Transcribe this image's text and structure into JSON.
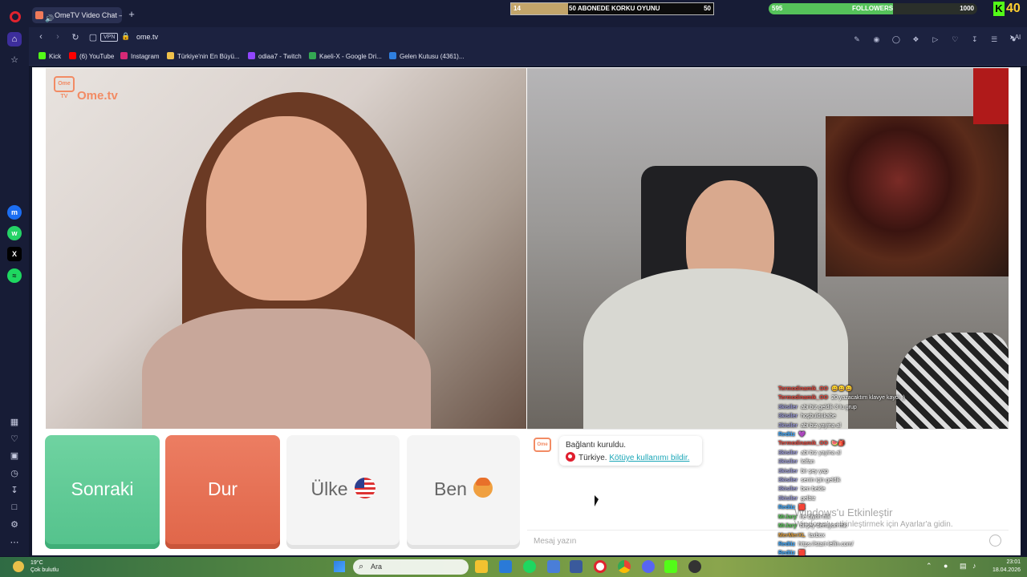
{
  "browser": {
    "tab_title": "OmeTV Video Chat —",
    "url": "ome.tv",
    "vpn_label": "VPN",
    "ai_label": "AI"
  },
  "stream_overlay": {
    "goal": {
      "current": "14",
      "title": "50 ABONEDE KORKU OYUNU",
      "target": "50",
      "progress": 0.28
    },
    "followers": {
      "current": "595",
      "label": "FOLLOWERS",
      "target": "1000",
      "progress": 0.595
    },
    "kick_count": "40"
  },
  "bookmarks": [
    {
      "label": "Kick",
      "color": "#53fc18"
    },
    {
      "label": "(6) YouTube",
      "color": "#ff0000"
    },
    {
      "label": "Instagram",
      "color": "#d62976"
    },
    {
      "label": "Türkiye'nin En Büyü...",
      "color": "#f0c14b"
    },
    {
      "label": "odiaa7 - Twitch",
      "color": "#9146ff"
    },
    {
      "label": "Kaeli-X - Google Dri...",
      "color": "#34a853"
    },
    {
      "label": "Gelen Kutusu (4361)...",
      "color": "#2f7fe0"
    }
  ],
  "sidebar_icons": [
    "home-icon",
    "star-icon",
    "messenger-icon",
    "whatsapp-icon",
    "x-icon",
    "spotify-icon",
    "apps-icon",
    "heart-icon",
    "wallet-icon",
    "history-icon",
    "download-icon",
    "box-icon",
    "settings-icon",
    "more-icon"
  ],
  "ometv": {
    "logo_text": "Ome.tv",
    "logo_badge": "Ome TV",
    "buttons": {
      "next": "Sonraki",
      "stop": "Dur",
      "country": "Ülke",
      "me": "Ben"
    },
    "system_message": {
      "title": "Bağlantı kuruldu.",
      "country": "Türkiye.",
      "report_link": "Kötüye kullanımı bildir."
    },
    "message_placeholder": "Mesaj yazın"
  },
  "stream_chat": [
    {
      "user": "Termodinamik_OO",
      "text": "😀😀😀",
      "color": "#e0443a"
    },
    {
      "user": "Termodinamik_OO",
      "text": "20 yazacaktım klavye kaydı ;)",
      "color": "#e0443a"
    },
    {
      "user": "3kisiler",
      "text": "abi biz geldik 3 lu grup",
      "color": "#9a9ad8"
    },
    {
      "user": "3kisiler",
      "text": "hoşbuldukabe",
      "color": "#9a9ad8"
    },
    {
      "user": "3kisiler",
      "text": "abi biz yayina al",
      "color": "#9a9ad8"
    },
    {
      "user": "Redtiz",
      "text": "💜",
      "color": "#3aa8ff"
    },
    {
      "user": "Termodinamik_OO",
      "text": "🍉🎒",
      "color": "#e0443a"
    },
    {
      "user": "3kisiler",
      "text": "abi biz yayina al",
      "color": "#9a9ad8"
    },
    {
      "user": "3kisiler",
      "text": "lolfan",
      "color": "#9a9ad8"
    },
    {
      "user": "3kisiler",
      "text": "bir şey yap",
      "color": "#9a9ad8"
    },
    {
      "user": "3kisiler",
      "text": "senin için geldik",
      "color": "#9a9ad8"
    },
    {
      "user": "3kisiler",
      "text": "ben bekle",
      "color": "#9a9ad8"
    },
    {
      "user": "3kisiler",
      "text": "gelbiz",
      "color": "#9a9ad8"
    },
    {
      "user": "Redtiz",
      "text": "🟥",
      "color": "#3aa8ff"
    },
    {
      "user": "MrJary",
      "text": "ne diyon mk",
      "color": "#5ac85a"
    },
    {
      "user": "MrJary",
      "text": "birşey demiyon mk",
      "color": "#5ac85a"
    },
    {
      "user": "MerMerXL",
      "text": "laxbox",
      "color": "#d89a3a"
    },
    {
      "user": "Redtiz",
      "text": "https://start-lelfin.com/",
      "color": "#3aa8ff"
    },
    {
      "user": "Redtiz",
      "text": "🟥",
      "color": "#3aa8ff"
    }
  ],
  "windows_activation": {
    "line1": "Windows'u Etkinleştir",
    "line2": "Windows'u etkinleştirmek için Ayarlar'a gidin."
  },
  "taskbar": {
    "weather_temp": "19°C",
    "weather_desc": "Çok bulutlu",
    "search_label": "Ara",
    "time": "23:01",
    "date": "18.04.2026"
  }
}
